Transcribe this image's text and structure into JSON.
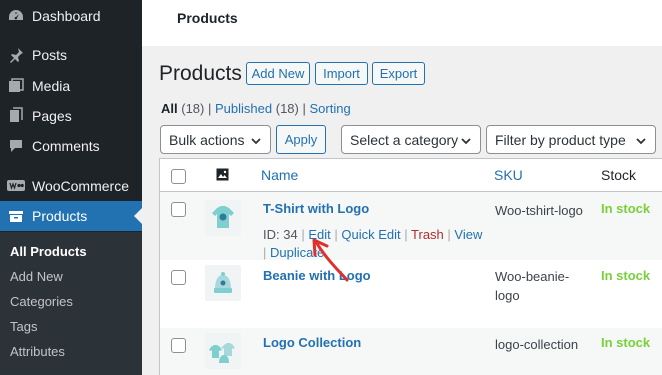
{
  "sidebar": {
    "items": [
      {
        "label": "Dashboard",
        "icon": "dashboard-icon"
      },
      {
        "label": "Posts",
        "icon": "pushpin-icon"
      },
      {
        "label": "Media",
        "icon": "media-icon"
      },
      {
        "label": "Pages",
        "icon": "pages-icon"
      },
      {
        "label": "Comments",
        "icon": "comment-icon"
      },
      {
        "label": "WooCommerce",
        "icon": "woocommerce-icon"
      },
      {
        "label": "Products",
        "icon": "products-icon"
      }
    ],
    "submenu": [
      "All Products",
      "Add New",
      "Categories",
      "Tags",
      "Attributes"
    ]
  },
  "topbar": {
    "title": "Products"
  },
  "header": {
    "title": "Products",
    "add_new": "Add New",
    "import": "Import",
    "export": "Export"
  },
  "filters": {
    "all_label": "All",
    "all_count": "(18)",
    "published_label": "Published",
    "published_count": "(18)",
    "sorting_label": "Sorting",
    "separator": "|"
  },
  "toolbar": {
    "bulk_actions": "Bulk actions",
    "apply": "Apply",
    "category": "Select a category",
    "product_type": "Filter by product type"
  },
  "table": {
    "columns": {
      "name": "Name",
      "sku": "SKU",
      "stock": "Stock",
      "thumb_icon": "image-icon"
    },
    "rows": [
      {
        "name": "T-Shirt with Logo",
        "sku": "Woo-tshirt-logo",
        "stock": "In stock"
      },
      {
        "name": "Beanie with Logo",
        "sku_line1": "Woo-beanie-",
        "sku_line2": "logo",
        "stock": "In stock"
      },
      {
        "name": "Logo Collection",
        "sku": "logo-collection",
        "stock": "In stock"
      }
    ],
    "row_actions": {
      "id": "ID: 34",
      "sep": "|",
      "edit": "Edit",
      "quick_edit": "Quick Edit",
      "trash": "Trash",
      "view": "View",
      "duplicate": "Duplicate"
    }
  },
  "colors": {
    "accent": "#2271b1",
    "sidebar": "#1d2327",
    "in_stock": "#7ad03a",
    "trash": "#b32d2e",
    "annotation": "#e0302c"
  }
}
